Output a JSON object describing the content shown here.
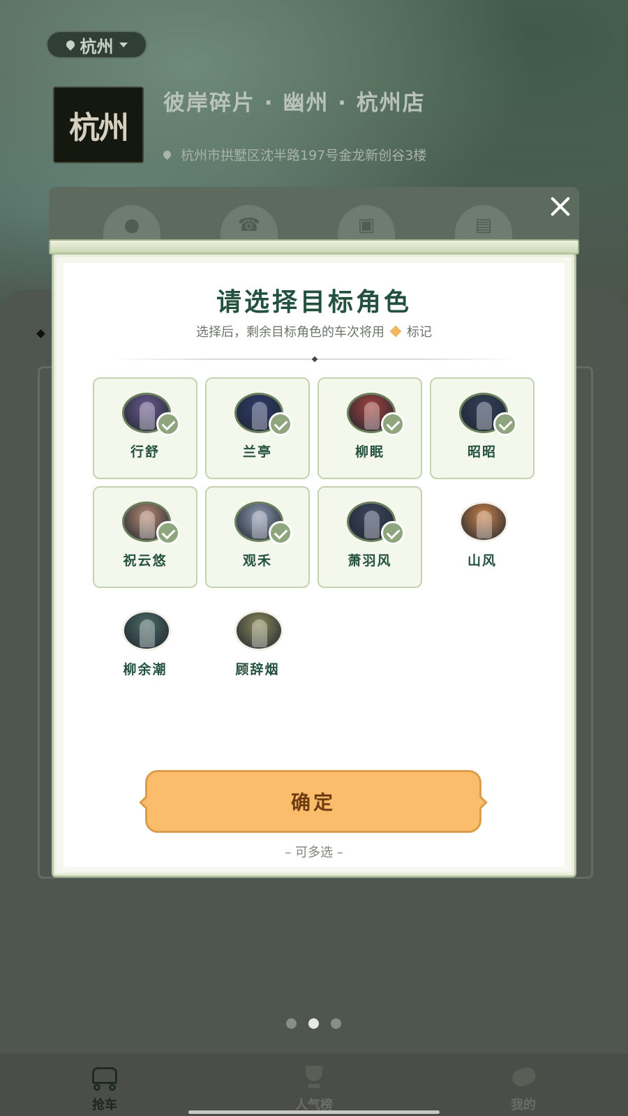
{
  "header": {
    "city": "杭州",
    "store_logo_text": "杭州",
    "store_name": "彼岸碎片 · 幽州 · 杭州店",
    "store_address": "杭州市拱墅区沈半路197号金龙新创谷3楼"
  },
  "modal": {
    "title": "请选择目标角色",
    "subtitle_before": "选择后，剩余目标角色的车次将用",
    "subtitle_after": "标记",
    "marker_color": "#f2b75c",
    "characters": [
      {
        "name": "行舒",
        "selected": true,
        "avatar_color": "#6b5a8e"
      },
      {
        "name": "兰亭",
        "selected": true,
        "avatar_color": "#2d3c6b"
      },
      {
        "name": "柳眠",
        "selected": true,
        "avatar_color": "#a4423d"
      },
      {
        "name": "昭昭",
        "selected": true,
        "avatar_color": "#33405c"
      },
      {
        "name": "祝云悠",
        "selected": true,
        "avatar_color": "#b68a72"
      },
      {
        "name": "观禾",
        "selected": true,
        "avatar_color": "#8f9ab3"
      },
      {
        "name": "萧羽风",
        "selected": true,
        "avatar_color": "#3c4660"
      },
      {
        "name": "山风",
        "selected": false,
        "avatar_color": "#c7824a"
      },
      {
        "name": "柳余潮",
        "selected": false,
        "avatar_color": "#4c6a64"
      },
      {
        "name": "顾辞烟",
        "selected": false,
        "avatar_color": "#8a8a5a"
      }
    ],
    "confirm_label": "确定",
    "multi_select_hint": "– 可多选 –"
  },
  "pager": {
    "total": 3,
    "active_index": 1
  },
  "tab_bar": {
    "tabs": [
      {
        "label": "抢车",
        "icon": "carriage-icon",
        "active": true
      },
      {
        "label": "人气榜",
        "icon": "trophy-icon",
        "active": false
      },
      {
        "label": "我的",
        "icon": "scroll-icon",
        "active": false
      }
    ]
  },
  "colors": {
    "title_green": "#24503f",
    "confirm_orange": "#fbbd6c",
    "check_green": "#8ea57d"
  }
}
